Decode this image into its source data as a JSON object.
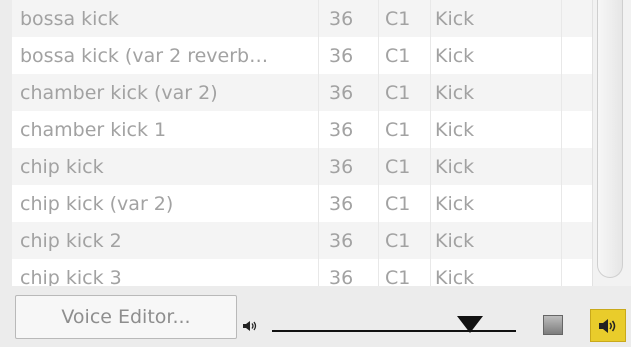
{
  "drum_list": {
    "rows": [
      {
        "name": "bossa kick",
        "number": "36",
        "note": "C1",
        "category": "Kick"
      },
      {
        "name": "bossa kick (var 2 reverb…",
        "number": "36",
        "note": "C1",
        "category": "Kick"
      },
      {
        "name": "chamber kick (var 2)",
        "number": "36",
        "note": "C1",
        "category": "Kick"
      },
      {
        "name": "chamber kick 1",
        "number": "36",
        "note": "C1",
        "category": "Kick"
      },
      {
        "name": "chip kick",
        "number": "36",
        "note": "C1",
        "category": "Kick"
      },
      {
        "name": "chip kick (var 2)",
        "number": "36",
        "note": "C1",
        "category": "Kick"
      },
      {
        "name": "chip kick 2",
        "number": "36",
        "note": "C1",
        "category": "Kick"
      },
      {
        "name": "chip kick 3",
        "number": "36",
        "note": "C1",
        "category": "Kick"
      }
    ]
  },
  "controls": {
    "voice_editor_label": "Voice Editor...",
    "volume_icon": "speaker-small-icon",
    "stop_icon": "stop-icon",
    "speaker_icon": "speaker-icon",
    "accent_color": "#e9cc2b"
  }
}
